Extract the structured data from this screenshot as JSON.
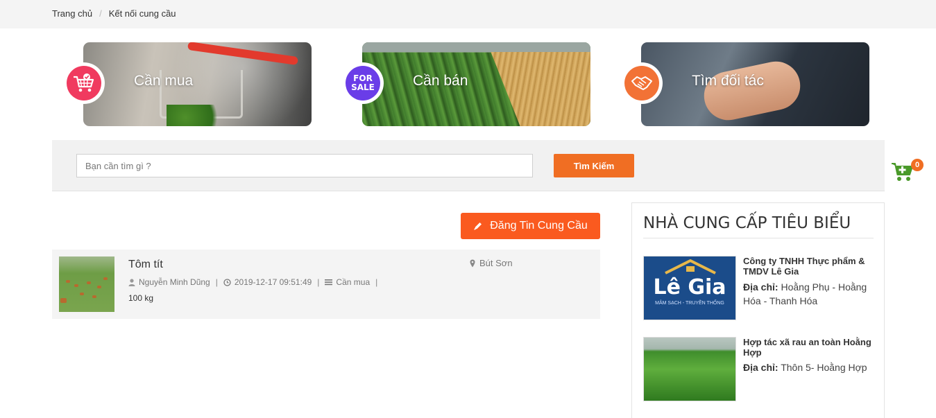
{
  "breadcrumb": {
    "home": "Trang chủ",
    "separator": "/",
    "current": "Kết nối cung cầu"
  },
  "banners": [
    {
      "label": "Cần mua",
      "icon": "cart-check-icon",
      "color": "#f03a5f"
    },
    {
      "label": "Cần bán",
      "icon": "for-sale-icon",
      "color": "#6a3de8",
      "badge_text": [
        "FOR",
        "SALE"
      ]
    },
    {
      "label": "Tìm đối tác",
      "icon": "handshake-icon",
      "color": "#f27236"
    }
  ],
  "search": {
    "placeholder": "Bạn cần tìm gì ?",
    "button": "Tìm Kiếm"
  },
  "cart": {
    "count": "0",
    "color": "#4a9a2a"
  },
  "post_button": "Đăng Tin Cung Cầu",
  "listing": {
    "title": "Tôm tít",
    "author": "Nguyễn Minh Dũng",
    "datetime": "2019-12-17 09:51:49",
    "category": "Cần mua",
    "quantity": "100 kg",
    "location": "Bút Sơn"
  },
  "suppliers": {
    "title": "NHÀ CUNG CẤP TIÊU BIỂU",
    "address_label": "Địa chỉ:",
    "items": [
      {
        "name": "Công ty TNHH Thực phẩm & TMDV Lê Gia",
        "address": "Hoằng Phụ - Hoằng Hóa - Thanh Hóa",
        "logo_text": "Lê Gia",
        "logo_sub": "MÂM SẠCH - TRUYỀN THỐNG"
      },
      {
        "name": "Hợp tác xã rau an toàn Hoằng Hợp",
        "address": "Thôn 5- Hoằng Hợp"
      }
    ]
  }
}
